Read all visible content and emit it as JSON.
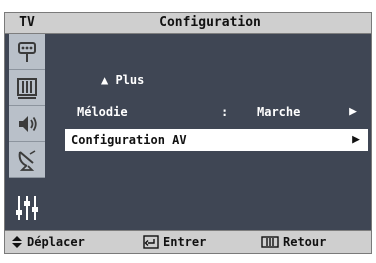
{
  "header": {
    "source": "TV",
    "title": "Configuration"
  },
  "sidebar": {
    "items": [
      {
        "icon": "antenna-icon"
      },
      {
        "icon": "picture-icon"
      },
      {
        "icon": "sound-icon"
      },
      {
        "icon": "channel-icon"
      },
      {
        "icon": "setup-icon",
        "active": true
      }
    ]
  },
  "menu": {
    "more_label": "▲ Plus",
    "rows": [
      {
        "label": "Mélodie",
        "separator": ":",
        "value": "Marche",
        "arrow": "▶",
        "selected": false
      },
      {
        "label": "Configuration AV",
        "arrow": "▶",
        "selected": true
      }
    ]
  },
  "footer": {
    "move_label": "Déplacer",
    "enter_label": "Entrer",
    "return_label": "Retour"
  },
  "colors": {
    "panel": "#3f4654",
    "bar": "#cfcfcf",
    "sidebar": "#b9c0c9",
    "highlight": "#ffffff"
  }
}
